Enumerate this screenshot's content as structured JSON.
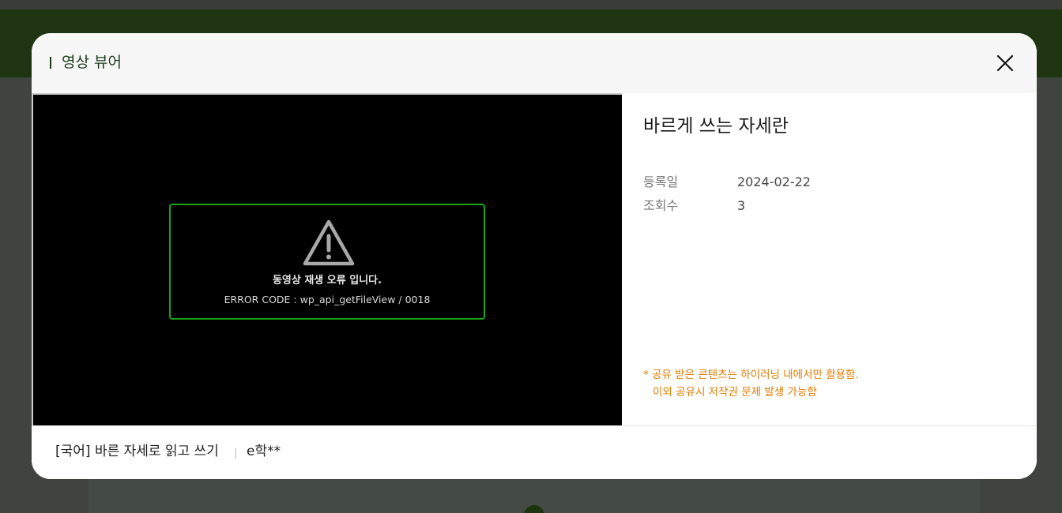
{
  "modal": {
    "title": "영상 뷰어",
    "close_icon": "close-icon"
  },
  "video": {
    "error_message": "동영상 재생 오류 입니다.",
    "error_code": "ERROR CODE : wp_api_getFileView / 0018",
    "warning_icon": "warning-triangle-icon",
    "border_color": "#18a518"
  },
  "info": {
    "title": "바르게 쓰는 자세란",
    "meta": [
      {
        "label": "등록일",
        "value": "2024-02-22"
      },
      {
        "label": "조회수",
        "value": "3"
      }
    ],
    "notice_line1": "*  공유 받은 콘텐츠는 하이러닝 내에서만 활용함.",
    "notice_line2": "이외 공유시 저작권 문제 발생 가능함",
    "notice_color": "#e07b00"
  },
  "footer": {
    "course_title": "[국어] 바른 자세로 읽고 쓰기",
    "author": "e학**"
  }
}
